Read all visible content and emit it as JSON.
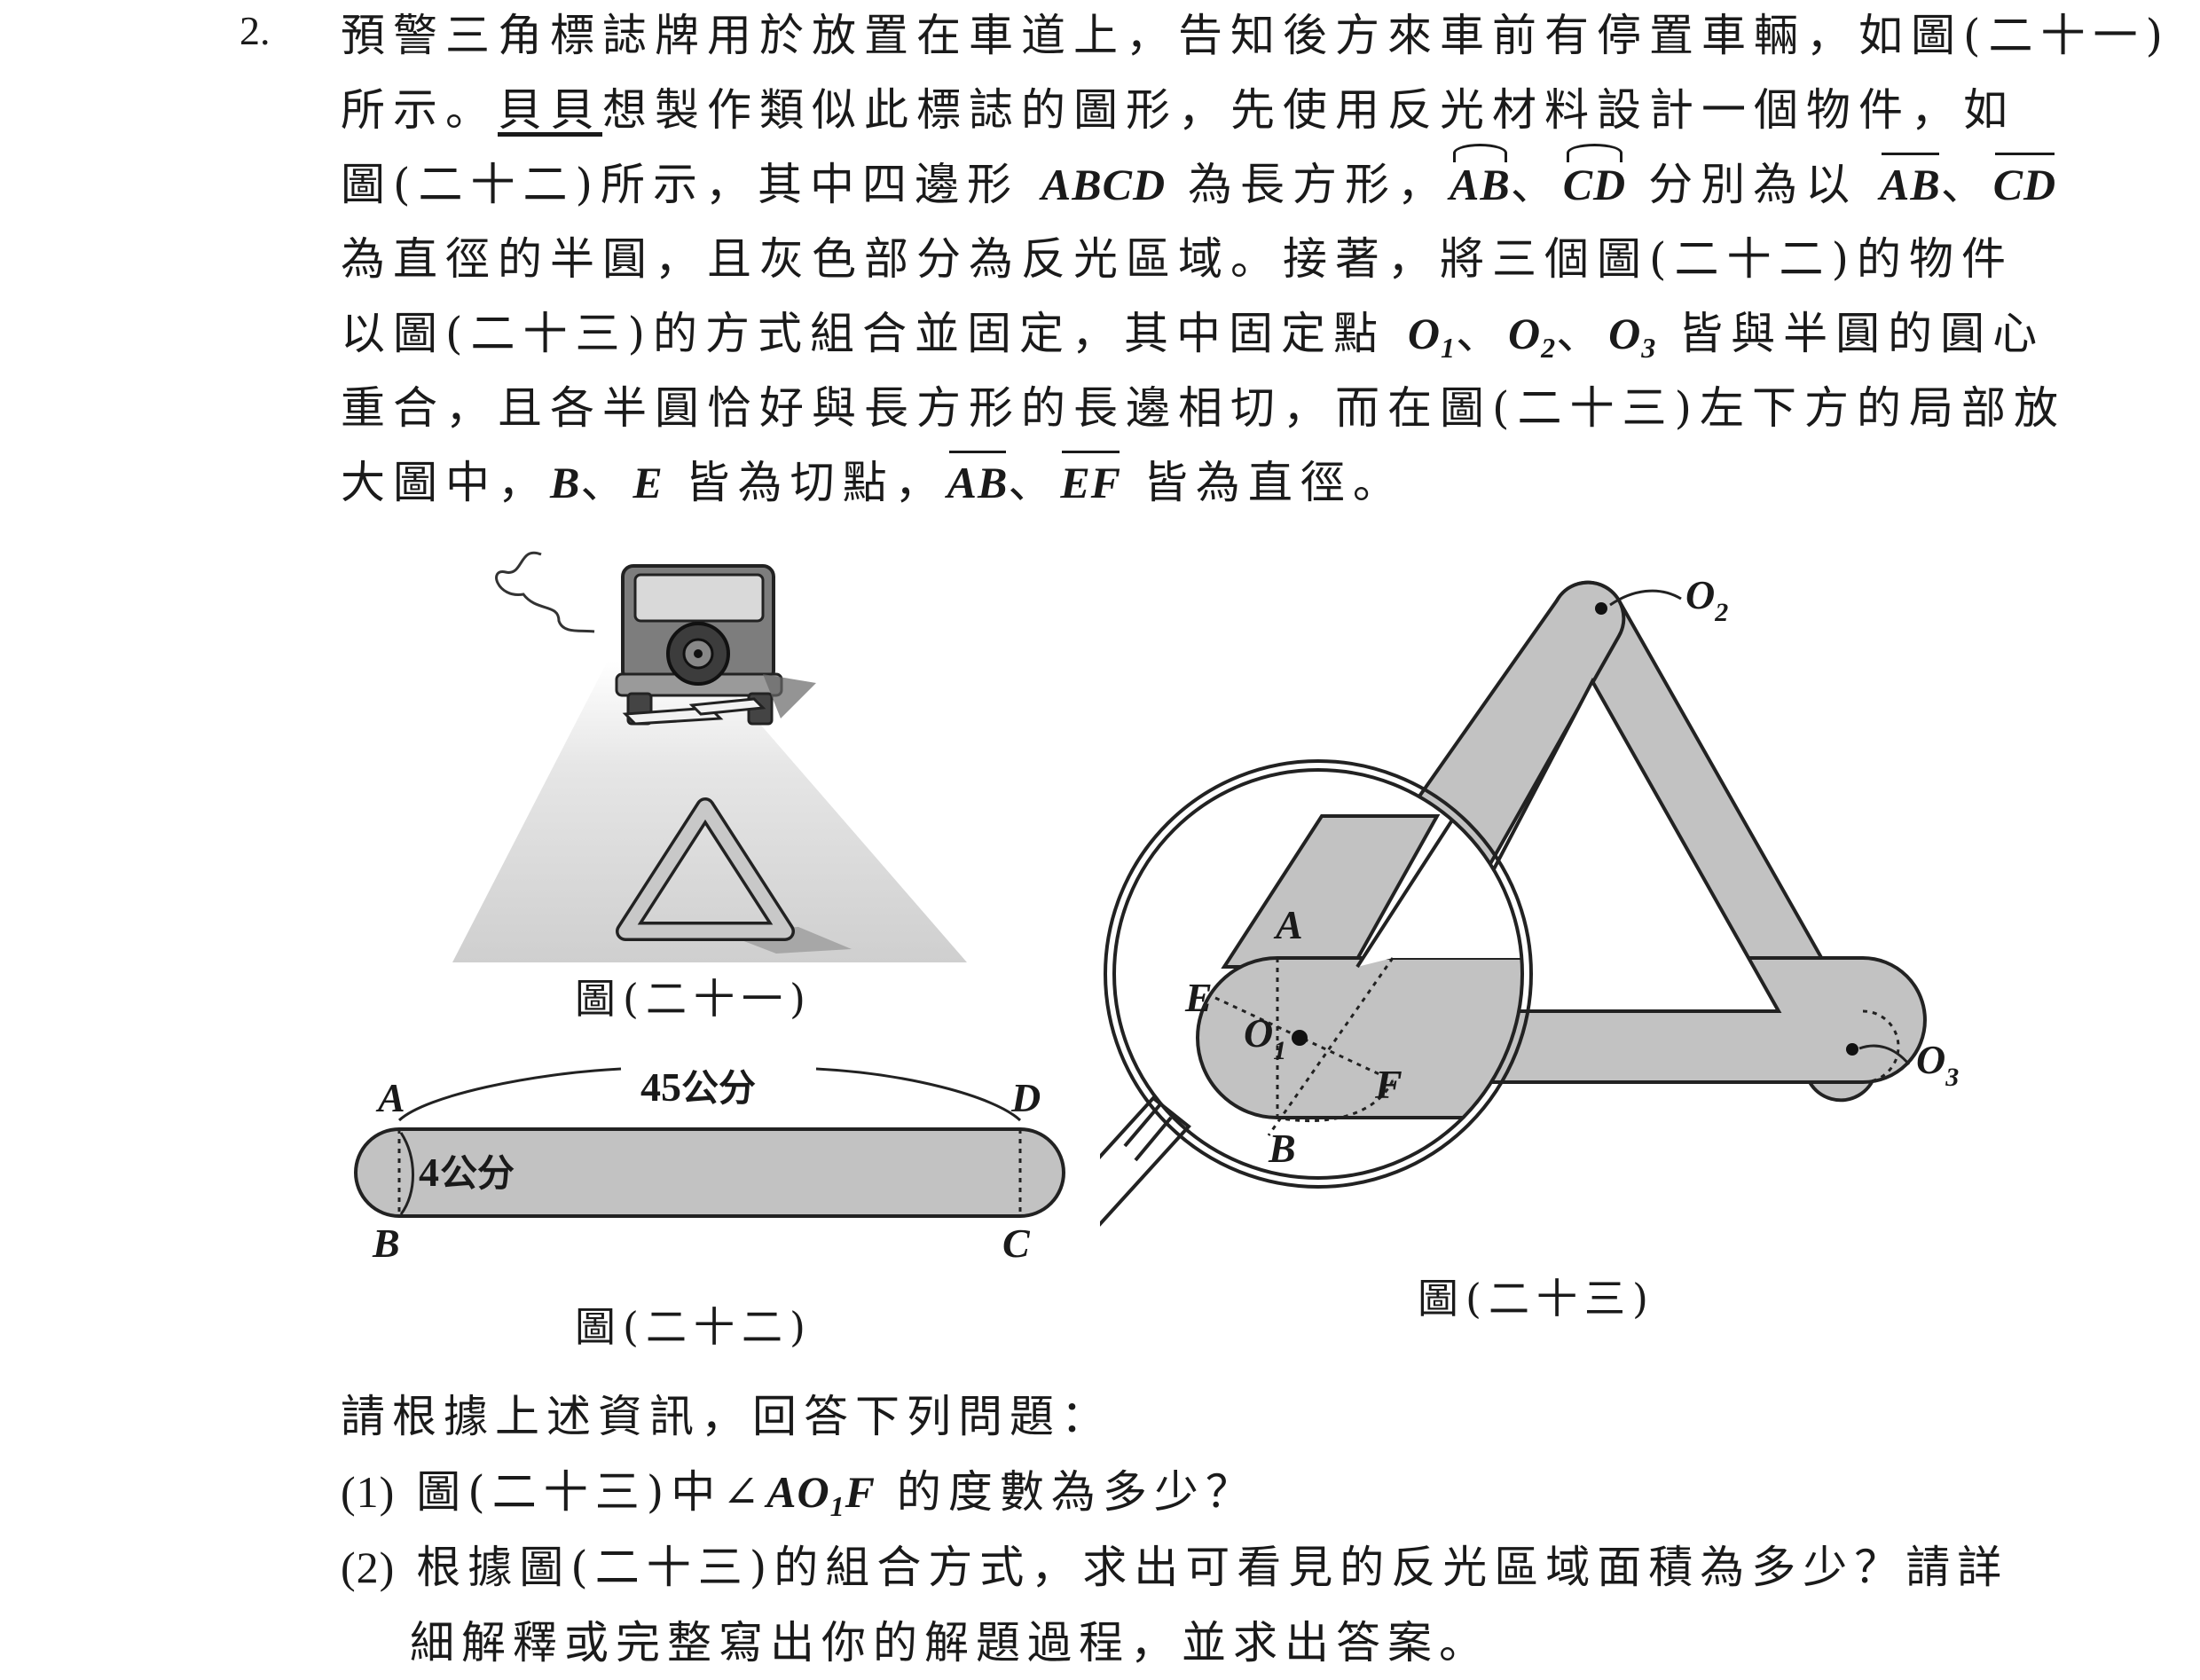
{
  "question_number": "2.",
  "paragraph": {
    "l1": "預警三角標誌牌用於放置在車道上，告知後方來車前有停置車輛，如圖(二十一)",
    "l2_pre": "所示。",
    "l2_name": "貝貝",
    "l2_post": "想製作類似此標誌的圖形，先使用反光材料設計一個物件，如",
    "l3_a": "圖(二十二)所示，其中四邊形",
    "l3_abcd": "ABCD",
    "l3_b": "為長方形，",
    "l3_arc_ab": "AB",
    "l3_sep1": "、",
    "l3_arc_cd": "CD",
    "l3_c": "分別為以",
    "l3_seg_ab": "AB",
    "l3_sep2": "、",
    "l3_seg_cd": "CD",
    "l4": "為直徑的半圓，且灰色部分為反光區域。接著，將三個圖(二十二)的物件",
    "l5_a": "以圖(二十三)的方式組合並固定，其中固定點",
    "l5_o1": "O",
    "l5_o2": "O",
    "l5_o3": "O",
    "l5_sub1": "1",
    "l5_sub2": "2",
    "l5_sub3": "3",
    "l5_sep": "、",
    "l5_b": "皆與半圓的圓心",
    "l6": "重合，且各半圓恰好與長方形的長邊相切，而在圖(二十三)左下方的局部放",
    "l7_a": "大圖中，",
    "l7_b": "B",
    "l7_sep": "、",
    "l7_e": "E",
    "l7_c": "皆為切點，",
    "l7_seg_ab": "AB",
    "l7_sep2": "、",
    "l7_seg_ef": "EF",
    "l7_d": "皆為直徑。"
  },
  "figures": {
    "fig21_caption": "圖(二十一)",
    "fig22_caption": "圖(二十二)",
    "fig23_caption": "圖(二十三)",
    "fig22": {
      "length_value": "45",
      "length_unit": "公分",
      "width_value": "4",
      "width_unit": "公分",
      "labels": {
        "A": "A",
        "B": "B",
        "C": "C",
        "D": "D"
      }
    },
    "fig23": {
      "labels": {
        "O2": "O",
        "O2_sub": "2",
        "O3": "O",
        "O3_sub": "3",
        "O1": "O",
        "O1_sub": "1",
        "A": "A",
        "B": "B",
        "E": "E",
        "F": "F"
      }
    },
    "colors": {
      "reflective_gray": "#c2c2c2",
      "outline": "#222222"
    }
  },
  "questions": {
    "intro": "請根據上述資訊，回答下列問題：",
    "q1_num": "(1)",
    "q1_a": "圖(二十三)中∠",
    "q1_ao": "AO",
    "q1_sub": "1",
    "q1_f": "F",
    "q1_b": "的度數為多少？",
    "q2_num": "(2)",
    "q2_l1": "根據圖(二十三)的組合方式，求出可看見的反光區域面積為多少？請詳",
    "q2_l2": "細解釋或完整寫出你的解題過程，並求出答案。"
  }
}
